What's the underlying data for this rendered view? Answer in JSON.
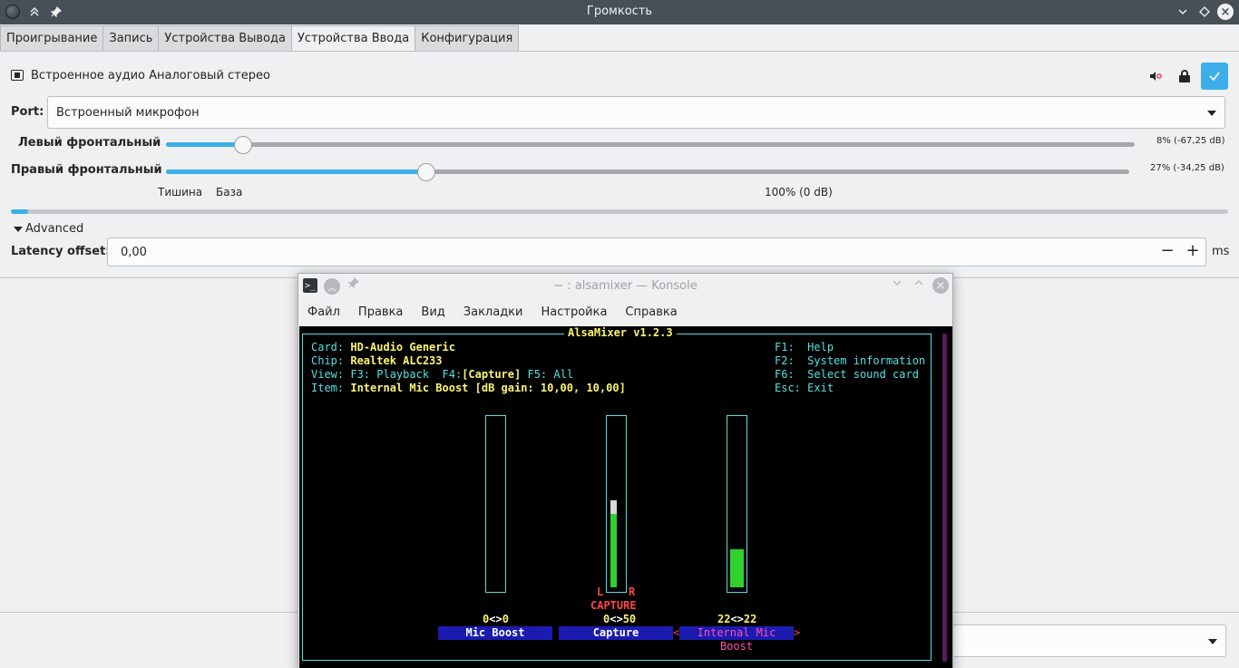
{
  "window": {
    "title": "Громкость"
  },
  "tabs": [
    {
      "label": "Проигрывание"
    },
    {
      "label": "Запись"
    },
    {
      "label": "Устройства Вывода"
    },
    {
      "label": "Устройства Ввода",
      "active": true
    },
    {
      "label": "Конфигурация"
    }
  ],
  "device": {
    "name": "Встроенное аудио Аналоговый стерео",
    "default_icon": "checkmark-icon",
    "mute_icon": "speaker-muted-icon",
    "lock_icon": "lock-icon"
  },
  "port": {
    "label": "Port:",
    "value": "Встроенный микрофон"
  },
  "channels": [
    {
      "label": "Левый фронтальный",
      "value_text": "8% (-67,25 dB)",
      "percent": 8
    },
    {
      "label": "Правый фронтальный",
      "value_text": "27% (-34,25 dB)",
      "percent": 27
    }
  ],
  "scale": {
    "silence": "Тишина",
    "base": "База",
    "full": "100% (0 dB)"
  },
  "level_meter_fraction": 0.014,
  "advanced": {
    "label": "Advanced",
    "latency_label": "Latency offset:",
    "latency_value": "0,00",
    "minus": "−",
    "plus": "+",
    "unit": "ms"
  },
  "konsole": {
    "title": "~ : alsamixer — Konsole",
    "menu": [
      "Файл",
      "Правка",
      "Вид",
      "Закладки",
      "Настройка",
      "Справка"
    ],
    "alsamixer": {
      "header": "AlsaMixer v1.2.3",
      "card_label": "Card:",
      "card_value": "HD-Audio Generic",
      "chip_label": "Chip:",
      "chip_value": "Realtek ALC233",
      "view_label": "View:",
      "view_f3": "F3: Playback",
      "view_f4": "F4:",
      "view_capture": "[Capture]",
      "view_f5": "F5: All",
      "item_label": "Item:",
      "item_value": "Internal Mic Boost [dB gain: 10,00, 10,00]",
      "help": [
        {
          "key": "F1:",
          "text": "Help"
        },
        {
          "key": "F2:",
          "text": "System information"
        },
        {
          "key": "F6:",
          "text": "Select sound card"
        },
        {
          "key": "Esc:",
          "text": "Exit"
        }
      ],
      "capture_l": "L",
      "capture_r": "R",
      "capture_word": "CAPTURE",
      "controls": [
        {
          "name": "Mic Boost",
          "left": "0",
          "sep": "<>",
          "right": "0",
          "level_fraction": 0.0
        },
        {
          "name": "Capture",
          "left": "0",
          "sep": "<>",
          "right": "50",
          "level_fraction": 0.5,
          "peak_fraction": 0.08
        },
        {
          "name": "Internal Mic Boost",
          "left": "22",
          "sep": "<>",
          "right": "22",
          "level_fraction": 0.24,
          "selected": true,
          "bracket_open": "<",
          "bracket_close": ">"
        }
      ]
    }
  },
  "colors": {
    "accent": "#3daee9",
    "titlebar": "#475057",
    "term_cyan": "#54e0e0",
    "term_yellow": "#fcf46f",
    "term_green": "#2fd12f",
    "term_red": "#ff4545",
    "term_blue": "#1b1bb1"
  }
}
